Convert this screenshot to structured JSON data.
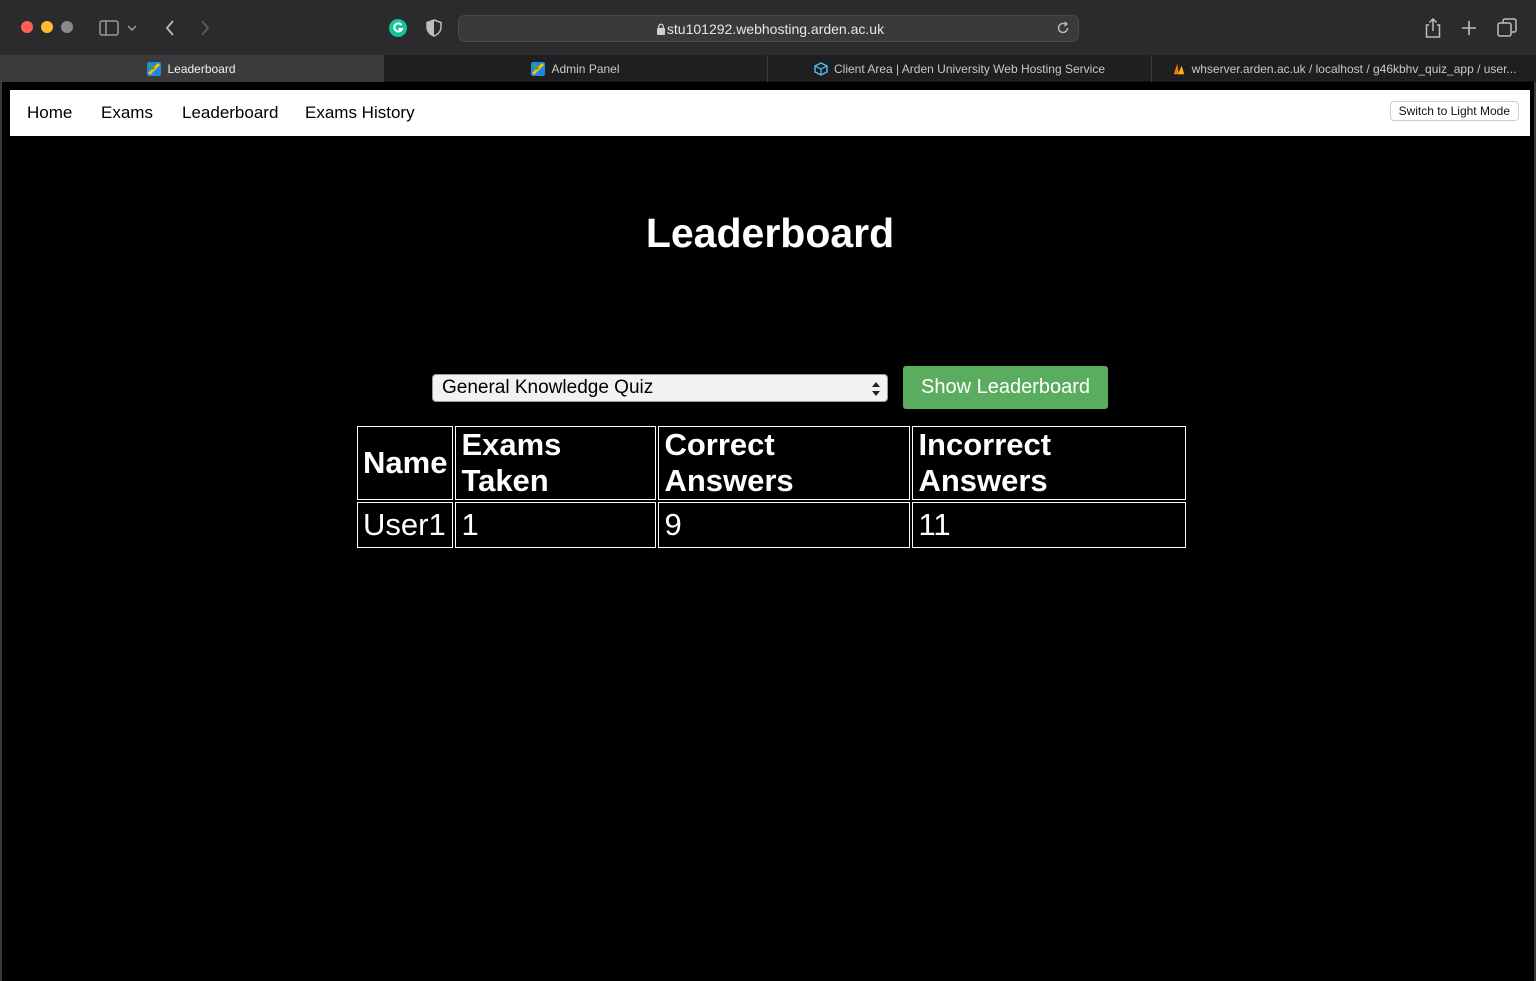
{
  "browser": {
    "url": "stu101292.webhosting.arden.ac.uk",
    "tabs": [
      {
        "label": "Leaderboard",
        "active": true
      },
      {
        "label": "Admin Panel",
        "active": false
      },
      {
        "label": "Client Area | Arden University Web Hosting Service",
        "active": false
      },
      {
        "label": "whserver.arden.ac.uk / localhost / g46kbhv_quiz_app / user...",
        "active": false
      }
    ]
  },
  "nav": {
    "items": [
      "Home",
      "Exams",
      "Leaderboard",
      "Exams History"
    ],
    "mode_toggle": "Switch to Light Mode"
  },
  "page": {
    "title": "Leaderboard",
    "quiz_select": {
      "selected": "General Knowledge Quiz"
    },
    "show_button": "Show Leaderboard"
  },
  "table": {
    "headers": [
      "Name",
      "Exams Taken",
      "Correct Answers",
      "Incorrect Answers"
    ],
    "rows": [
      [
        "User1",
        "1",
        "9",
        "11"
      ]
    ]
  },
  "colors": {
    "accent_green": "#5aad5e",
    "page_background": "#000000",
    "navbar_background": "#ffffff"
  }
}
